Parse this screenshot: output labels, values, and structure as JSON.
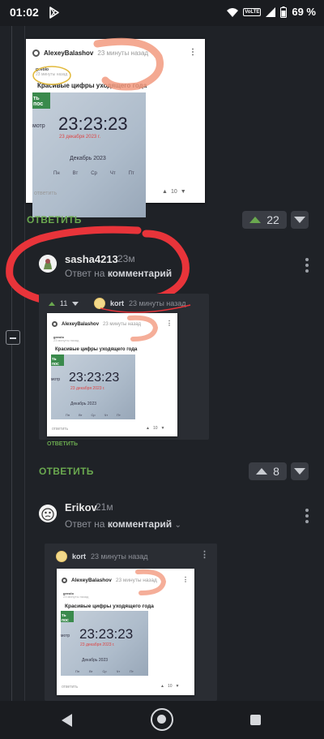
{
  "status_bar": {
    "time": "01:02",
    "network": "VoLTE",
    "battery": "69 %"
  },
  "screenshots": [
    {
      "author": "AlexeyBalashov",
      "time": "23 минуты назад",
      "mini_user": "geeolo",
      "mini_time": "23 минуты назад",
      "post_title": "Красивые цифры уходящего года",
      "green_label": "ть пос",
      "side_label": "мотр",
      "clock": "23:23:23",
      "date": "23 декабря 2023 г.",
      "month": "Декабрь 2023",
      "days": [
        "Пн",
        "Вт",
        "Ср",
        "Чт",
        "Пт"
      ],
      "reply": "ответить",
      "votes": "10"
    }
  ],
  "comment1": {
    "reply_label": "ОТВЕТИТЬ",
    "score": "22"
  },
  "comment2": {
    "username": "sasha4213",
    "age": "23м",
    "reply_prefix": "Ответ на",
    "reply_target": "комментарий",
    "quote_user": "kort",
    "quote_time": "23 минуты назад",
    "quote_votes": "11",
    "quote_reply": "ОТВЕТИТЬ",
    "reply_label": "ОТВЕТИТЬ",
    "score": "8"
  },
  "comment3": {
    "username": "Erikov",
    "age": "21м",
    "reply_prefix": "Ответ на",
    "reply_target": "комментарий",
    "quote_user": "kort",
    "quote_time": "23 минуты назад"
  },
  "colors": {
    "accent": "#6aa84f",
    "background": "#1f2227",
    "highlight_red": "#e8343a"
  }
}
